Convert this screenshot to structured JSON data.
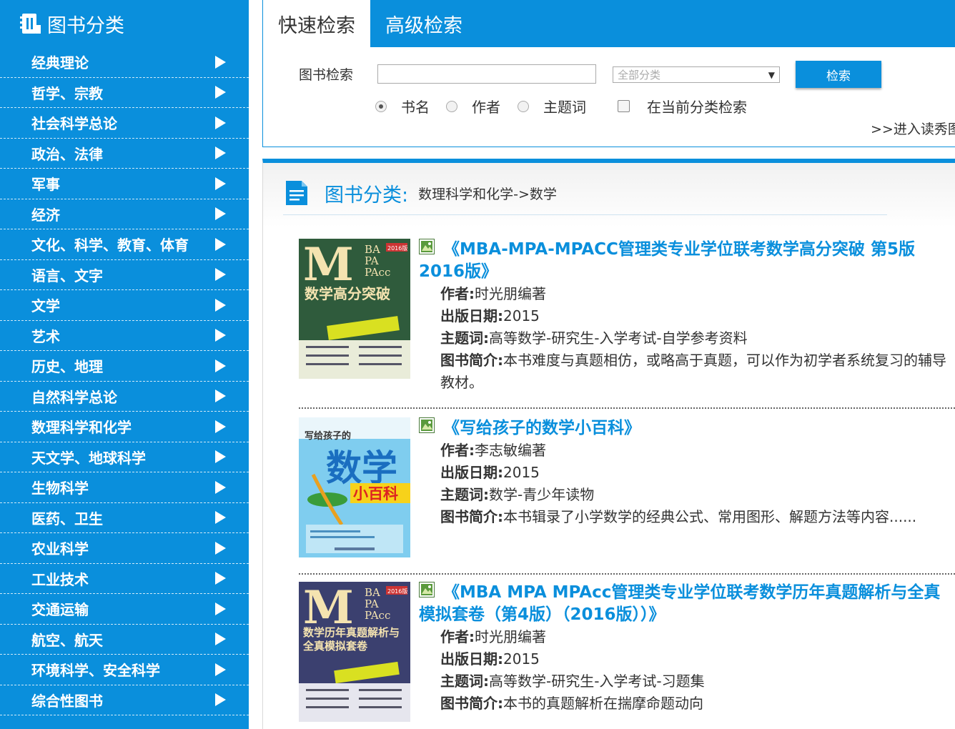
{
  "sidebar": {
    "title": "图书分类",
    "items": [
      {
        "label": "经典理论"
      },
      {
        "label": "哲学、宗教"
      },
      {
        "label": "社会科学总论"
      },
      {
        "label": "政治、法律"
      },
      {
        "label": "军事"
      },
      {
        "label": "经济"
      },
      {
        "label": "文化、科学、教育、体育"
      },
      {
        "label": "语言、文字"
      },
      {
        "label": "文学"
      },
      {
        "label": "艺术"
      },
      {
        "label": "历史、地理"
      },
      {
        "label": "自然科学总论"
      },
      {
        "label": "数理科学和化学"
      },
      {
        "label": "天文学、地球科学"
      },
      {
        "label": "生物科学"
      },
      {
        "label": "医药、卫生"
      },
      {
        "label": "农业科学"
      },
      {
        "label": "工业技术"
      },
      {
        "label": "交通运输"
      },
      {
        "label": "航空、航天"
      },
      {
        "label": "环境科学、安全科学"
      },
      {
        "label": "综合性图书"
      }
    ]
  },
  "search": {
    "tabs": [
      {
        "label": "快速检索"
      },
      {
        "label": "高级检索"
      }
    ],
    "label": "图书检索",
    "input_value": "",
    "category_select": "全部分类",
    "button": "检索",
    "radios": [
      {
        "label": "书名",
        "checked": true
      },
      {
        "label": "作者",
        "checked": false
      },
      {
        "label": "主题词",
        "checked": false
      }
    ],
    "checkbox_label": "在当前分类检索",
    "enter_link": ">>进入读秀图"
  },
  "results": {
    "breadcrumb_title": "图书分类:",
    "breadcrumb_path": "数理科学和化学->数学",
    "field_labels": {
      "author": "作者:",
      "date": "出版日期:",
      "subject": "主题词:",
      "summary": "图书简介:"
    },
    "books": [
      {
        "title": "《MBA-MPA-MPACC管理类专业学位联考数学高分突破 第5版 2016版》",
        "author": "时光朋编著",
        "date": "2015",
        "subject": "高等数学-研究生-入学考试-自学参考资料",
        "summary": "本书难度与真题相仿，或略高于真题，可以作为初学者系统复习的辅导教材。",
        "cover": {
          "big_letter": "M",
          "side": [
            "BA",
            "PA",
            "PAcc"
          ],
          "year": "2016版",
          "main": "数学高分突破",
          "bg": "#2e5a3a"
        }
      },
      {
        "title": "《写给孩子的数学小百科》",
        "author": "李志敏编著",
        "date": "2015",
        "subject": "数学-青少年读物",
        "summary": "本书辑录了小学数学的经典公式、常用图形、解题方法等内容......",
        "cover": {
          "top": "写给孩子的",
          "big": "数学",
          "sub": "小百科",
          "bg": "#3ab0e0"
        }
      },
      {
        "title": "《MBA MPA MPAcc管理类专业学位联考数学历年真题解析与全真模拟套卷（第4版）（2016版））》",
        "author": "时光朋编著",
        "date": "2015",
        "subject": "高等数学-研究生-入学考试-习题集",
        "summary": "本书的真题解析在揣摩命题动向",
        "cover": {
          "big_letter": "M",
          "side": [
            "BA",
            "PA",
            "PAcc"
          ],
          "year": "2016版",
          "main": "数学历年真题解析与全真模拟套卷",
          "bg": "#3a3f6e"
        }
      }
    ]
  }
}
